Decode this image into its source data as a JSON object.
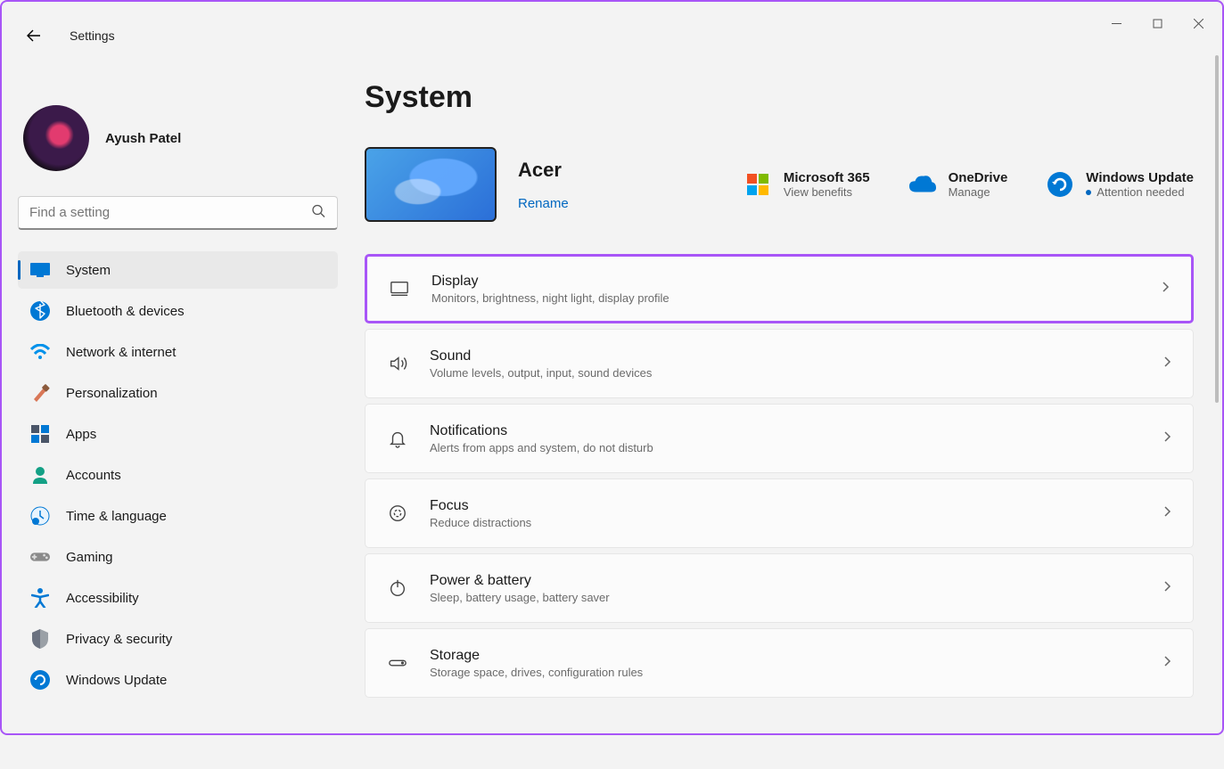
{
  "app_title": "Settings",
  "profile": {
    "name": "Ayush Patel"
  },
  "search": {
    "placeholder": "Find a setting"
  },
  "sidebar": {
    "items": [
      {
        "label": "System",
        "icon": "system",
        "selected": true
      },
      {
        "label": "Bluetooth & devices",
        "icon": "bluetooth"
      },
      {
        "label": "Network & internet",
        "icon": "wifi"
      },
      {
        "label": "Personalization",
        "icon": "brush"
      },
      {
        "label": "Apps",
        "icon": "apps"
      },
      {
        "label": "Accounts",
        "icon": "person"
      },
      {
        "label": "Time & language",
        "icon": "clock"
      },
      {
        "label": "Gaming",
        "icon": "gamepad"
      },
      {
        "label": "Accessibility",
        "icon": "accessibility"
      },
      {
        "label": "Privacy & security",
        "icon": "shield"
      },
      {
        "label": "Windows Update",
        "icon": "update"
      }
    ]
  },
  "page": {
    "title": "System",
    "device_name": "Acer",
    "rename_label": "Rename",
    "quick_links": [
      {
        "title": "Microsoft 365",
        "sub": "View benefits",
        "icon": "ms365"
      },
      {
        "title": "OneDrive",
        "sub": "Manage",
        "icon": "onedrive"
      },
      {
        "title": "Windows Update",
        "sub": "Attention needed",
        "icon": "update-blue",
        "dot": true
      }
    ],
    "settings": [
      {
        "title": "Display",
        "sub": "Monitors, brightness, night light, display profile",
        "icon": "display",
        "highlight": true
      },
      {
        "title": "Sound",
        "sub": "Volume levels, output, input, sound devices",
        "icon": "sound"
      },
      {
        "title": "Notifications",
        "sub": "Alerts from apps and system, do not disturb",
        "icon": "bell"
      },
      {
        "title": "Focus",
        "sub": "Reduce distractions",
        "icon": "focus"
      },
      {
        "title": "Power & battery",
        "sub": "Sleep, battery usage, battery saver",
        "icon": "power"
      },
      {
        "title": "Storage",
        "sub": "Storage space, drives, configuration rules",
        "icon": "storage"
      }
    ]
  }
}
